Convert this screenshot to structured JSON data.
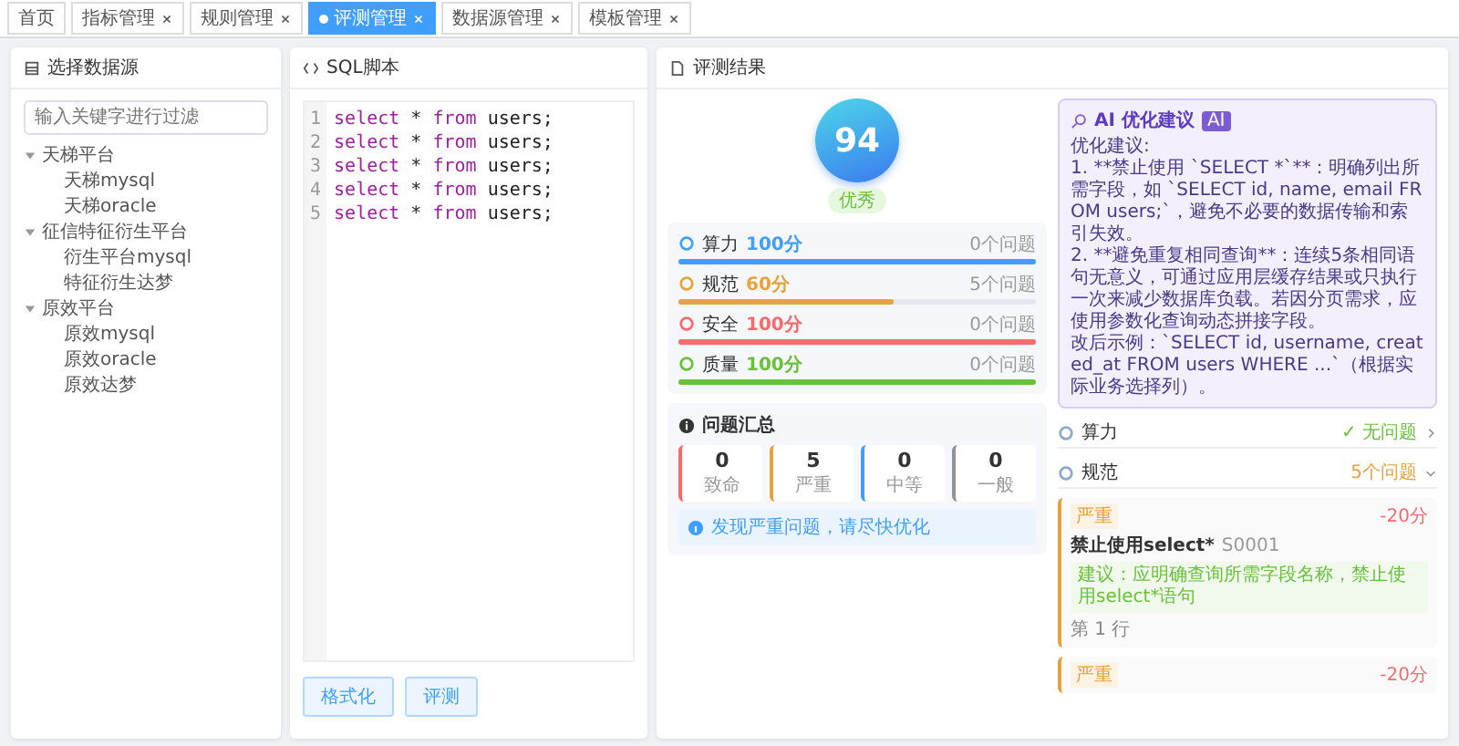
{
  "tabs": [
    {
      "label": "首页",
      "closable": false,
      "selected": false
    },
    {
      "label": "指标管理",
      "closable": true,
      "selected": false
    },
    {
      "label": "规则管理",
      "closable": true,
      "selected": false
    },
    {
      "label": "评测管理",
      "closable": true,
      "selected": true
    },
    {
      "label": "数据源管理",
      "closable": true,
      "selected": false
    },
    {
      "label": "模板管理",
      "closable": true,
      "selected": false
    }
  ],
  "datasource": {
    "title": "选择数据源",
    "filter": {
      "placeholder": "输入关键字进行过滤"
    },
    "tree": [
      {
        "label": "天梯平台",
        "expanded": true,
        "children": [
          {
            "label": "天梯mysql"
          },
          {
            "label": "天梯oracle"
          }
        ]
      },
      {
        "label": "征信特征衍生平台",
        "expanded": true,
        "children": [
          {
            "label": "衍生平台mysql"
          },
          {
            "label": "特征衍生达梦"
          }
        ]
      },
      {
        "label": "原效平台",
        "expanded": true,
        "children": [
          {
            "label": "原效mysql"
          },
          {
            "label": "原效oracle"
          },
          {
            "label": "原效达梦"
          }
        ]
      }
    ]
  },
  "editor": {
    "title": "SQL脚本",
    "lines": [
      {
        "number": "1",
        "tokens": [
          {
            "kind": "keyword",
            "text": "select"
          },
          {
            "kind": "plain",
            "text": " * "
          },
          {
            "kind": "keyword",
            "text": "from"
          },
          {
            "kind": "plain",
            "text": " users;"
          }
        ]
      },
      {
        "number": "2",
        "tokens": [
          {
            "kind": "keyword",
            "text": "select"
          },
          {
            "kind": "plain",
            "text": " * "
          },
          {
            "kind": "keyword",
            "text": "from"
          },
          {
            "kind": "plain",
            "text": " users;"
          }
        ]
      },
      {
        "number": "3",
        "tokens": [
          {
            "kind": "keyword",
            "text": "select"
          },
          {
            "kind": "plain",
            "text": " * "
          },
          {
            "kind": "keyword",
            "text": "from"
          },
          {
            "kind": "plain",
            "text": " users;"
          }
        ]
      },
      {
        "number": "4",
        "tokens": [
          {
            "kind": "keyword",
            "text": "select"
          },
          {
            "kind": "plain",
            "text": " * "
          },
          {
            "kind": "keyword",
            "text": "from"
          },
          {
            "kind": "plain",
            "text": " users;"
          }
        ]
      },
      {
        "number": "5",
        "tokens": [
          {
            "kind": "keyword",
            "text": "select"
          },
          {
            "kind": "plain",
            "text": " * "
          },
          {
            "kind": "keyword",
            "text": "from"
          },
          {
            "kind": "plain",
            "text": " users;"
          }
        ]
      }
    ],
    "buttons": [
      "格式化",
      "评测"
    ]
  },
  "result": {
    "title": "评测结果",
    "score": "94",
    "grade": "优秀",
    "metrics": [
      {
        "name": "算力",
        "score": "100分",
        "issues": "0个问题",
        "level": 1,
        "color": "#409eff"
      },
      {
        "name": "规范",
        "score": "60分",
        "issues": "5个问题",
        "level": 0.6,
        "color": "#e6a23c"
      },
      {
        "name": "安全",
        "score": "100分",
        "issues": "0个问题",
        "level": 1,
        "color": "#f56c6c"
      },
      {
        "name": "质量",
        "score": "100分",
        "issues": "0个问题",
        "level": 1,
        "color": "#67c23a"
      }
    ],
    "summary": {
      "title": "问题汇总",
      "counts": [
        {
          "value": "0",
          "label": "致命",
          "color": "#f56c6c"
        },
        {
          "value": "5",
          "label": "严重",
          "color": "#e6a23c"
        },
        {
          "value": "0",
          "label": "中等",
          "color": "#409eff"
        },
        {
          "value": "0",
          "label": "一般",
          "color": "#909399"
        }
      ],
      "notice": "发现严重问题，请尽快优化"
    },
    "ai": {
      "title": "AI 优化建议",
      "badge": "AI",
      "lines": [
        "优化建议:",
        "1. **禁止使用 `SELECT *`**：明确列出所需字段，如 `SELECT id, name, email FROM users;`，避免不必要的数据传输和索引失效。",
        "2. **避免重复相同查询**：连续5条相同语句无意义，可通过应用层缓存结果或只执行一次来减少数据库负载。若因分页需求，应使用参数化查询动态拼接字段。",
        "改后示例：`SELECT id, username, created_at FROM users WHERE ...`（根据实际业务选择列）。"
      ]
    },
    "sections": [
      {
        "name": "算力",
        "status": "✓ 无问题",
        "expanded": false,
        "color": "#67c23a"
      },
      {
        "name": "规范",
        "status": "5个问题",
        "expanded": true,
        "color": "#e6a23c"
      }
    ],
    "issues": [
      {
        "severity": "严重",
        "penalty": "-20分",
        "title": "禁止使用select*",
        "code": "S0001",
        "suggestion": "建议：应明确查询所需字段名称，禁止使用select*语句",
        "line": "第 1 行"
      },
      {
        "severity": "严重",
        "penalty": "-20分"
      }
    ]
  }
}
